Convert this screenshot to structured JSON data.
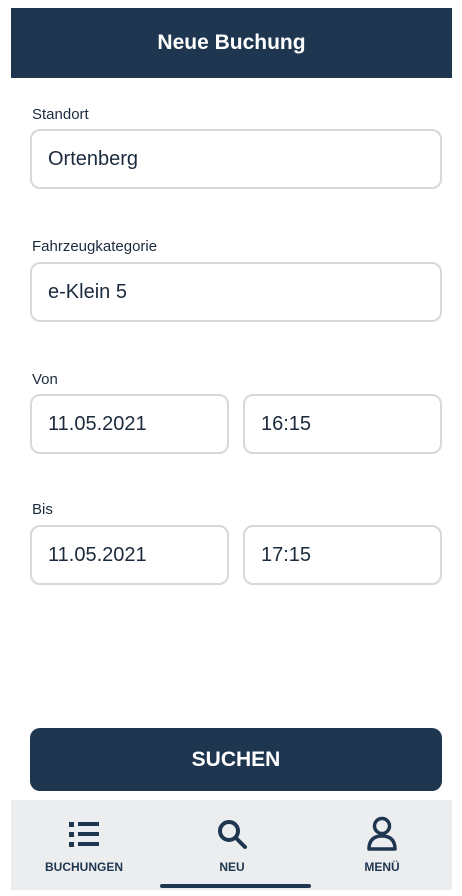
{
  "header": {
    "title": "Neue Buchung"
  },
  "form": {
    "standort": {
      "label": "Standort",
      "value": "Ortenberg"
    },
    "fahrzeugkategorie": {
      "label": "Fahrzeugkategorie",
      "value": "e-Klein 5"
    },
    "von": {
      "label": "Von",
      "date": "11.05.2021",
      "time": "16:15"
    },
    "bis": {
      "label": "Bis",
      "date": "11.05.2021",
      "time": "17:15"
    }
  },
  "search_button": {
    "label": "SUCHEN"
  },
  "nav": {
    "items": [
      {
        "label": "BUCHUNGEN",
        "icon": "list-icon"
      },
      {
        "label": "NEU",
        "icon": "search-icon"
      },
      {
        "label": "MENÜ",
        "icon": "person-icon"
      }
    ],
    "active": "NEU"
  },
  "colors": {
    "primary": "#1f3650",
    "field_border": "#d5d9de",
    "nav_bg": "#ebedef"
  }
}
